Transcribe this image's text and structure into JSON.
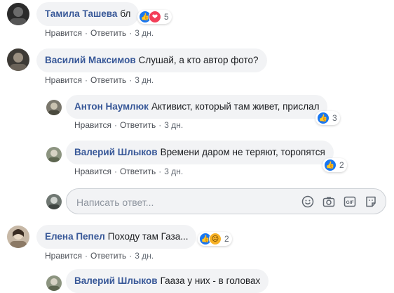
{
  "actions": {
    "like": "Нравится",
    "reply": "Ответить"
  },
  "comments": [
    {
      "author": "Тамила Ташева",
      "text": "бл",
      "time": "3 дн.",
      "reactions": {
        "count": "5",
        "types": [
          "like",
          "love"
        ]
      }
    },
    {
      "author": "Василий Максимов",
      "text": "Слушай, а кто автор фото?",
      "time": "3 дн."
    }
  ],
  "replies": [
    {
      "author": "Антон Наумлюк",
      "text": "Активист, который там живет, прислал",
      "time": "3 дн.",
      "reactions": {
        "count": "3",
        "types": [
          "like"
        ]
      }
    },
    {
      "author": "Валерий Шлыков",
      "text": "Времени даром не теряют, торопятся",
      "time": "3 дн.",
      "reactions": {
        "count": "2",
        "types": [
          "like"
        ]
      }
    }
  ],
  "reply_input": {
    "placeholder": "Написать ответ..."
  },
  "comment3": {
    "author": "Елена Пепел",
    "text": "Походу там Газа...",
    "time": "3 дн.",
    "reactions": {
      "count": "2",
      "types": [
        "like",
        "sad"
      ]
    }
  },
  "reply3": {
    "author": "Валерий Шлыков",
    "text": "Гааза у них - в головах"
  }
}
